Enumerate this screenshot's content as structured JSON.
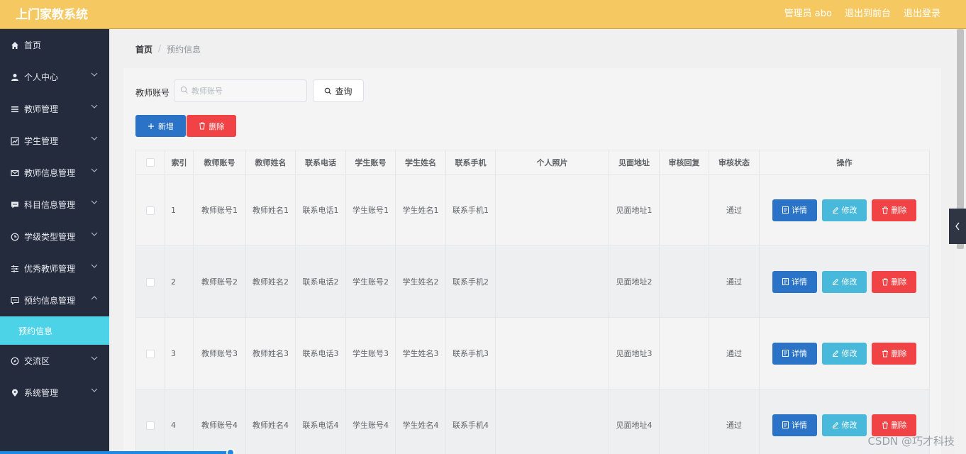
{
  "header": {
    "title": "上门家教系统",
    "admin_label": "管理员 abo",
    "front_link": "退出到前台",
    "logout_link": "退出登录"
  },
  "sidebar": {
    "items": [
      {
        "label": "首页",
        "icon": "home-icon"
      },
      {
        "label": "个人中心",
        "icon": "user-icon"
      },
      {
        "label": "教师管理",
        "icon": "list-icon"
      },
      {
        "label": "学生管理",
        "icon": "chart-icon"
      },
      {
        "label": "教师信息管理",
        "icon": "mail-icon"
      },
      {
        "label": "科目信息管理",
        "icon": "chat-icon"
      },
      {
        "label": "学级类型管理",
        "icon": "clock-icon"
      },
      {
        "label": "优秀教师管理",
        "icon": "sliders-icon"
      },
      {
        "label": "预约信息管理",
        "icon": "message-icon"
      },
      {
        "label": "预约信息",
        "icon": ""
      },
      {
        "label": "交流区",
        "icon": "compass-icon"
      },
      {
        "label": "系统管理",
        "icon": "pin-icon"
      }
    ]
  },
  "breadcrumb": {
    "home": "首页",
    "separator": "/",
    "current": "预约信息"
  },
  "search": {
    "label": "教师账号",
    "placeholder": "教师账号",
    "query_label": "查询"
  },
  "toolbar": {
    "add_label": "新增",
    "delete_label": "删除"
  },
  "table": {
    "columns": [
      "索引",
      "教师账号",
      "教师姓名",
      "联系电话",
      "学生账号",
      "学生姓名",
      "联系手机",
      "个人照片",
      "见面地址",
      "审核回复",
      "审核状态",
      "操作"
    ],
    "rows": [
      {
        "index": "1",
        "teacher_account": "教师账号1",
        "teacher_name": "教师姓名1",
        "phone": "联系电话1",
        "student_account": "学生账号1",
        "student_name": "学生姓名1",
        "mobile": "联系手机1",
        "photo": "",
        "address": "见面地址1",
        "reply": "",
        "status": "通过"
      },
      {
        "index": "2",
        "teacher_account": "教师账号2",
        "teacher_name": "教师姓名2",
        "phone": "联系电话2",
        "student_account": "学生账号2",
        "student_name": "学生姓名2",
        "mobile": "联系手机2",
        "photo": "",
        "address": "见面地址2",
        "reply": "",
        "status": "通过"
      },
      {
        "index": "3",
        "teacher_account": "教师账号3",
        "teacher_name": "教师姓名3",
        "phone": "联系电话3",
        "student_account": "学生账号3",
        "student_name": "学生姓名3",
        "mobile": "联系手机3",
        "photo": "",
        "address": "见面地址3",
        "reply": "",
        "status": "通过"
      },
      {
        "index": "4",
        "teacher_account": "教师账号4",
        "teacher_name": "教师姓名4",
        "phone": "联系电话4",
        "student_account": "学生账号4",
        "student_name": "学生姓名4",
        "mobile": "联系手机4",
        "photo": "",
        "address": "见面地址4",
        "reply": "",
        "status": "通过"
      }
    ],
    "actions": {
      "detail": "详情",
      "edit": "修改",
      "delete": "删除"
    }
  },
  "watermark": "CSDN @巧才科技",
  "colors": {
    "header": "#f5c862",
    "sidebar": "#242b3d",
    "active_submenu": "#4dd3e8",
    "primary": "#2a73c6",
    "info": "#48b9da",
    "danger": "#f14345"
  }
}
